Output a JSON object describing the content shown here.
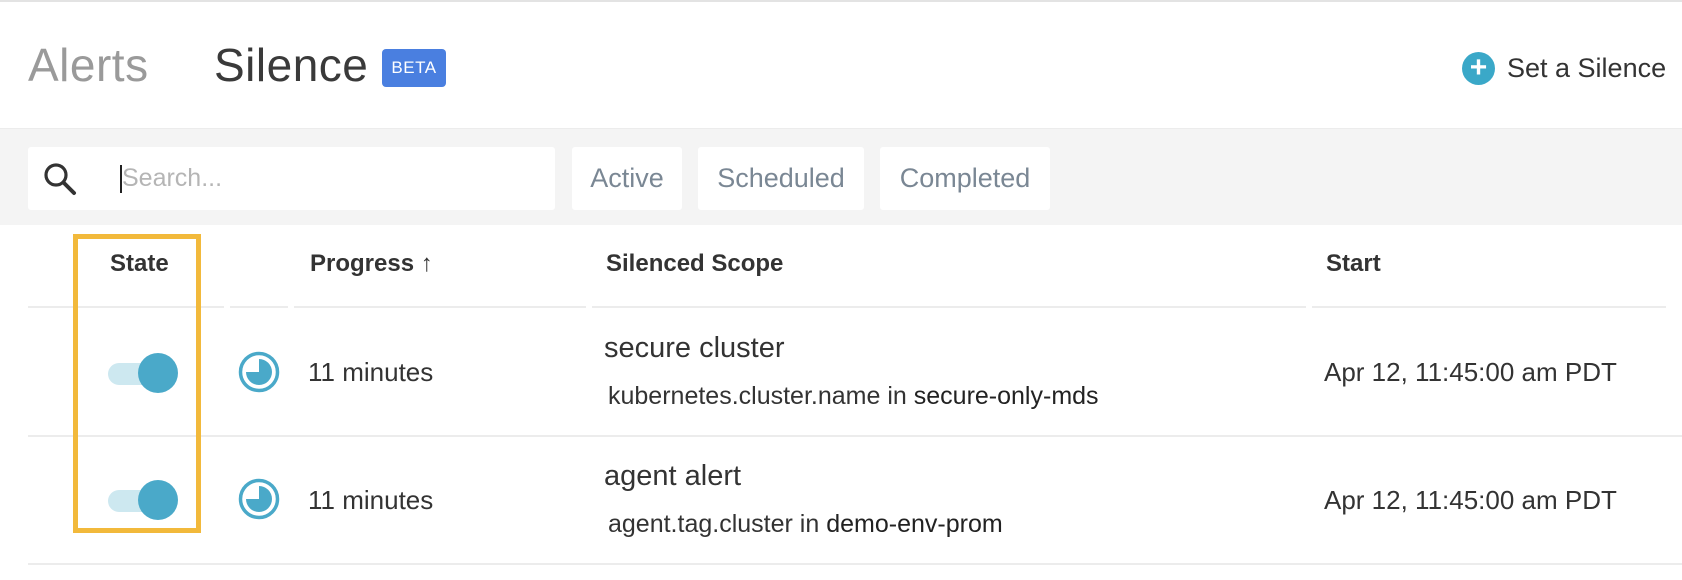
{
  "header": {
    "tabs": [
      {
        "label": "Alerts",
        "active": false
      },
      {
        "label": "Silence",
        "active": true
      }
    ],
    "beta_badge": "BETA",
    "set_silence_label": "Set a Silence"
  },
  "filter": {
    "search_placeholder": "Search...",
    "search_value": "",
    "buttons": [
      "Active",
      "Scheduled",
      "Completed"
    ]
  },
  "table": {
    "columns": {
      "state": "State",
      "progress": "Progress ↑",
      "scope": "Silenced Scope",
      "start": "Start"
    },
    "rows": [
      {
        "state_on": true,
        "progress": "11 minutes",
        "scope_name": "secure cluster",
        "scope_key": "kubernetes.cluster.name",
        "scope_op": "in",
        "scope_value": "secure-only-mds",
        "start": "Apr 12, 11:45:00 am PDT"
      },
      {
        "state_on": true,
        "progress": "11 minutes",
        "scope_name": "agent alert",
        "scope_key": "agent.tag.cluster",
        "scope_op": "in",
        "scope_value": "demo-env-prom",
        "start": "Apr 12, 11:45:00 am PDT"
      }
    ]
  },
  "colors": {
    "accent": "#4aa9c9",
    "beta": "#4a7fe0",
    "highlight": "#f2b93b"
  },
  "icons": {
    "search": "search-icon",
    "add": "plus-circle-icon",
    "progress": "clock-icon"
  }
}
